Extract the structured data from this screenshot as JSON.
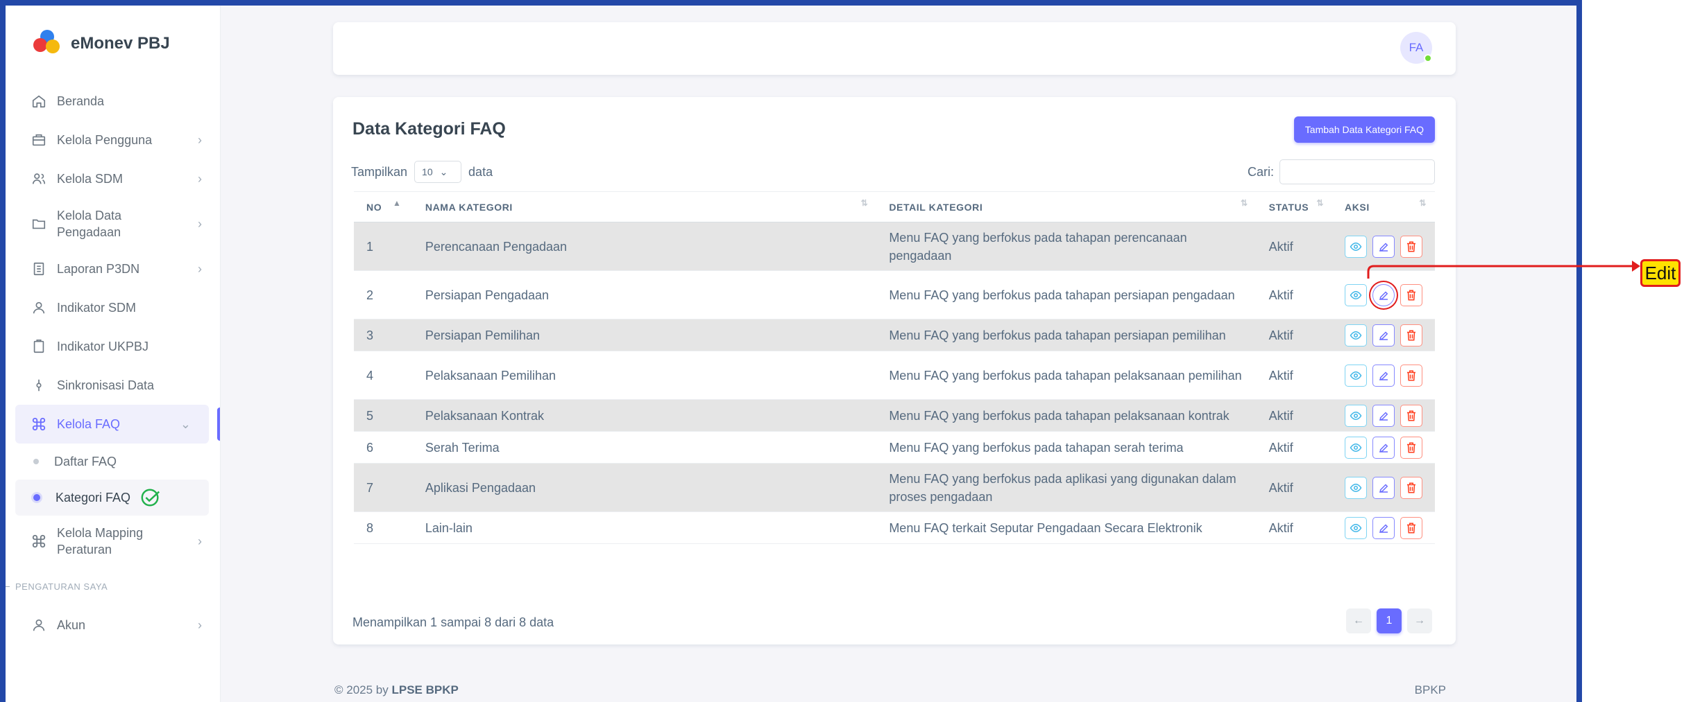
{
  "brand": {
    "name": "eMonev PBJ"
  },
  "sidebar": {
    "items": [
      {
        "label": "Beranda",
        "icon": "home-icon"
      },
      {
        "label": "Kelola Pengguna",
        "icon": "briefcase-icon"
      },
      {
        "label": "Kelola SDM",
        "icon": "users-icon"
      },
      {
        "label": "Kelola Data Pengadaan",
        "icon": "folder-icon"
      },
      {
        "label": "Laporan P3DN",
        "icon": "report-icon"
      },
      {
        "label": "Indikator SDM",
        "icon": "user-icon"
      },
      {
        "label": "Indikator UKPBJ",
        "icon": "clipboard-icon"
      },
      {
        "label": "Sinkronisasi Data",
        "icon": "sync-icon"
      },
      {
        "label": "Kelola FAQ",
        "icon": "command-icon"
      },
      {
        "label": "Kelola Mapping Peraturan",
        "icon": "command-icon"
      }
    ],
    "sub_items": [
      "Daftar FAQ",
      "Kategori FAQ"
    ],
    "section": "PENGATURAN SAYA",
    "account": {
      "label": "Akun",
      "icon": "user-icon"
    }
  },
  "topbar": {
    "avatar_initials": "FA"
  },
  "card": {
    "title": "Data Kategori FAQ",
    "add_button": "Tambah Data Kategori FAQ",
    "length_prefix": "Tampilkan",
    "length_value": "10",
    "length_suffix": "data",
    "search_label": "Cari:",
    "columns": [
      "NO",
      "NAMA KATEGORI",
      "DETAIL KATEGORI",
      "STATUS",
      "AKSI"
    ],
    "rows": [
      {
        "no": "1",
        "name": "Perencanaan Pengadaan",
        "detail": "Menu FAQ yang berfokus pada tahapan perencanaan pengadaan",
        "status": "Aktif"
      },
      {
        "no": "2",
        "name": "Persiapan Pengadaan",
        "detail": "Menu FAQ yang berfokus pada tahapan persiapan pengadaan",
        "status": "Aktif"
      },
      {
        "no": "3",
        "name": "Persiapan Pemilihan",
        "detail": "Menu FAQ yang berfokus pada tahapan persiapan pemilihan",
        "status": "Aktif"
      },
      {
        "no": "4",
        "name": "Pelaksanaan Pemilihan",
        "detail": "Menu FAQ yang berfokus pada tahapan pelaksanaan pemilihan",
        "status": "Aktif"
      },
      {
        "no": "5",
        "name": "Pelaksanaan Kontrak",
        "detail": "Menu FAQ yang berfokus pada tahapan pelaksanaan kontrak",
        "status": "Aktif"
      },
      {
        "no": "6",
        "name": "Serah Terima",
        "detail": "Menu FAQ yang berfokus pada tahapan serah terima",
        "status": "Aktif"
      },
      {
        "no": "7",
        "name": "Aplikasi Pengadaan",
        "detail": "Menu FAQ yang berfokus pada aplikasi yang digunakan dalam proses pengadaan",
        "status": "Aktif"
      },
      {
        "no": "8",
        "name": "Lain-lain",
        "detail": "Menu FAQ terkait Seputar Pengadaan Secara Elektronik",
        "status": "Aktif"
      }
    ],
    "info": "Menampilkan 1 sampai 8 dari 8 data",
    "pagination": {
      "prev": "←",
      "current": "1",
      "next": "→"
    }
  },
  "footer": {
    "copyright": "© 2025 by",
    "org": "LPSE BPKP",
    "right": "BPKP"
  },
  "annotation": {
    "label": "Edit",
    "color": "#e11d1d",
    "fill": "#ffe100"
  },
  "colors": {
    "primary": "#696cff",
    "frame": "#2348a8"
  }
}
